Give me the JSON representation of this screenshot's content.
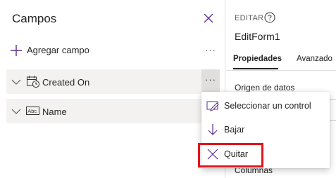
{
  "fields_pane": {
    "title": "Campos",
    "add_field_label": "Agregar campo",
    "more_glyph": "···",
    "fields": [
      {
        "label": "Created On",
        "icon": "calendar-clock-icon"
      },
      {
        "label": "Name",
        "icon": "text-abc-icon"
      }
    ]
  },
  "properties_pane": {
    "section_label": "EDITAR",
    "control_name": "EditForm1",
    "tabs": [
      {
        "label": "Propiedades",
        "active": true
      },
      {
        "label": "Avanzado",
        "active": false
      }
    ],
    "labels": {
      "data_source": "Origen de datos",
      "columns": "Columnas"
    }
  },
  "context_menu": {
    "items": [
      {
        "label": "Seleccionar un control",
        "icon": "select-control-icon"
      },
      {
        "label": "Bajar",
        "icon": "arrow-down-icon"
      },
      {
        "label": "Quitar",
        "icon": "remove-x-icon"
      }
    ]
  },
  "colors": {
    "highlight": "#e2141b",
    "accent": "#5c2d91",
    "row_bg": "#f3f2f1"
  }
}
